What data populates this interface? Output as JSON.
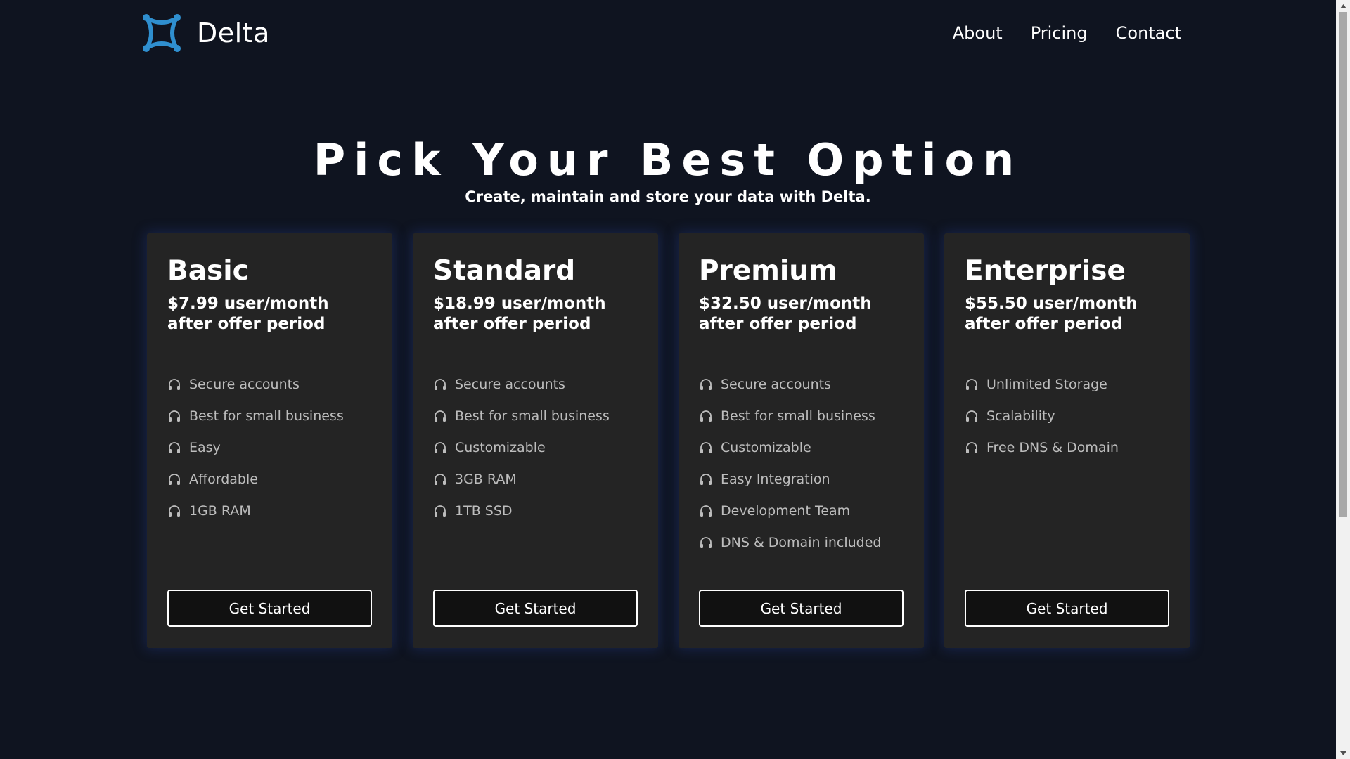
{
  "brand": {
    "name": "Delta",
    "logo_icon": "delta-logo-icon",
    "logo_color": "#2f8fcf"
  },
  "nav": {
    "items": [
      "About",
      "Pricing",
      "Contact"
    ]
  },
  "hero": {
    "title": "Pick Your Best Option",
    "subtitle": "Create, maintain and store your data with Delta."
  },
  "plans": [
    {
      "name": "Basic",
      "price": "$7.99 user/month after offer period",
      "features": [
        "Secure accounts",
        "Best for small business",
        "Easy",
        "Affordable",
        "1GB RAM"
      ],
      "button": "Get Started"
    },
    {
      "name": "Standard",
      "price": "$18.99 user/month after offer period",
      "features": [
        "Secure accounts",
        "Best for small business",
        "Customizable",
        "3GB RAM",
        "1TB SSD"
      ],
      "button": "Get Started"
    },
    {
      "name": "Premium",
      "price": "$32.50 user/month after offer period",
      "features": [
        "Secure accounts",
        "Best for small business",
        "Customizable",
        "Easy Integration",
        "Development Team",
        "DNS & Domain included"
      ],
      "button": "Get Started"
    },
    {
      "name": "Enterprise",
      "price": "$55.50 user/month after offer period",
      "features": [
        "Unlimited Storage",
        "Scalability",
        "Free DNS & Domain"
      ],
      "button": "Get Started"
    }
  ],
  "feature_icon": "headphones-icon",
  "colors": {
    "background": "#0f1420",
    "card": "#242424",
    "feature_text": "#bdbdbd",
    "card_glow": "#2846a0"
  }
}
